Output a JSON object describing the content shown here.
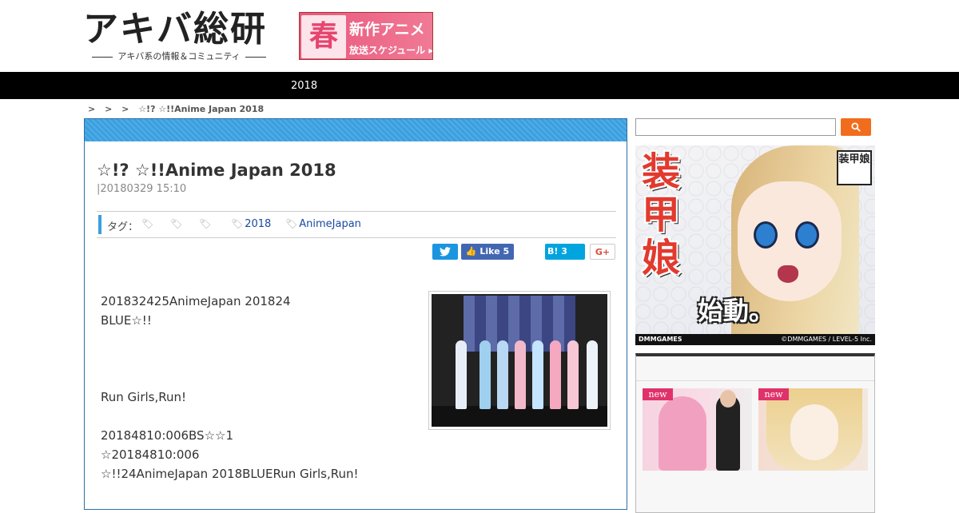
{
  "header": {
    "logo_main": "アキバ総研",
    "logo_sub": "アキバ系の情報＆コミュニティ",
    "banner": {
      "badge": "春",
      "line1": "新作アニメ",
      "line2": "放送スケジュール ▸"
    }
  },
  "nav": {
    "items": [
      {
        "label": "2018"
      }
    ]
  },
  "breadcrumb": {
    "separators": [
      ">",
      ">",
      ">"
    ],
    "current": "☆!? ☆!!Anime Japan 2018"
  },
  "article": {
    "title": "☆!? ☆!!Anime Japan 2018",
    "date": "|20180329 15:10",
    "tags_label": "タグ：",
    "tags": [
      {
        "label": ""
      },
      {
        "label": ""
      },
      {
        "label": ""
      },
      {
        "label": "2018"
      },
      {
        "label": "AnimeJapan"
      }
    ],
    "share": {
      "twitter": "",
      "facebook_like": "Like 5",
      "hatena": "B! 3",
      "gplus": "G+"
    },
    "paragraphs": [
      "201832425AnimeJapan 201824",
      "BLUE☆!!",
      "",
      "",
      "",
      "Run Girls,Run!",
      "",
      "20184810:006BS☆☆1",
      "☆20184810:006",
      "☆!!24AnimeJapan 2018BLUERun Girls,Run!"
    ]
  },
  "sidebar": {
    "search": {
      "placeholder": "",
      "button_icon": "search-icon"
    },
    "ad": {
      "title_vertical": "装甲娘",
      "catch": "始動。",
      "badge": "装甲娘",
      "footer_left": "DMMGAMES",
      "footer_right": "©DMMGAMES / LEVEL-5 Inc."
    },
    "widget": {
      "title": "",
      "items": [
        {
          "badge": "new"
        },
        {
          "badge": "new"
        }
      ]
    }
  },
  "colors": {
    "accent_blue": "#3aa0e0",
    "nav_bg": "#000000",
    "search_orange": "#f06d1e",
    "new_badge": "#e0326a"
  }
}
